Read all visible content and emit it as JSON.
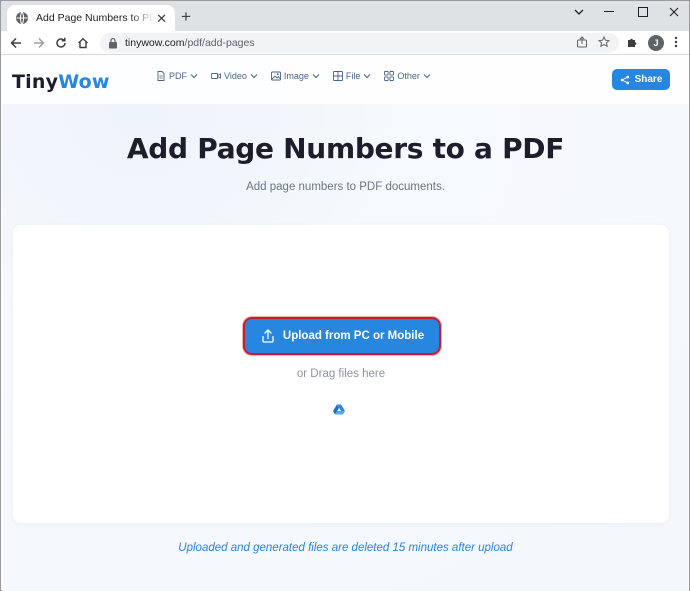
{
  "browser": {
    "tab_title": "Add Page Numbers to PDF Free",
    "url_host": "tinywow.com",
    "url_path": "/pdf/add-pages",
    "profile_initial": "J"
  },
  "navbar": {
    "logo_part1": "Tiny",
    "logo_part2": "Wow",
    "menu": [
      {
        "label": "PDF",
        "icon": "document-icon"
      },
      {
        "label": "Video",
        "icon": "video-icon"
      },
      {
        "label": "Image",
        "icon": "image-icon"
      },
      {
        "label": "File",
        "icon": "file-grid-icon"
      },
      {
        "label": "Other",
        "icon": "apps-icon"
      }
    ],
    "share_label": "Share"
  },
  "main": {
    "title": "Add Page Numbers to a PDF",
    "subtitle": "Add page numbers to PDF documents.",
    "upload_label": "Upload from PC or Mobile",
    "drag_text": "or Drag files here",
    "footer_note": "Uploaded and generated files are deleted 15 minutes after upload"
  },
  "colors": {
    "brand_blue": "#2686e0",
    "highlight_red": "#c81d2e",
    "heading": "#1d1d2b"
  }
}
